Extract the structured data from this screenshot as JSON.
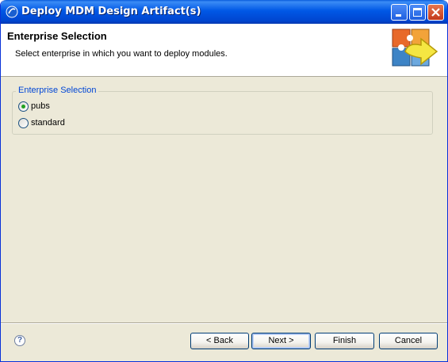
{
  "window": {
    "title": "Deploy MDM Design Artifact(s)"
  },
  "header": {
    "title": "Enterprise Selection",
    "description": "Select enterprise in which you want to deploy modules."
  },
  "group": {
    "label": "Enterprise Selection",
    "options": [
      {
        "label": "pubs",
        "selected": true
      },
      {
        "label": "standard",
        "selected": false
      }
    ]
  },
  "buttons": {
    "back": "< Back",
    "next": "Next >",
    "finish": "Finish",
    "cancel": "Cancel"
  },
  "help": {
    "glyph": "?"
  },
  "colors": {
    "titlebar": "#0058e6",
    "dialog_bg": "#ece9d8",
    "group_label": "#0046d5"
  }
}
